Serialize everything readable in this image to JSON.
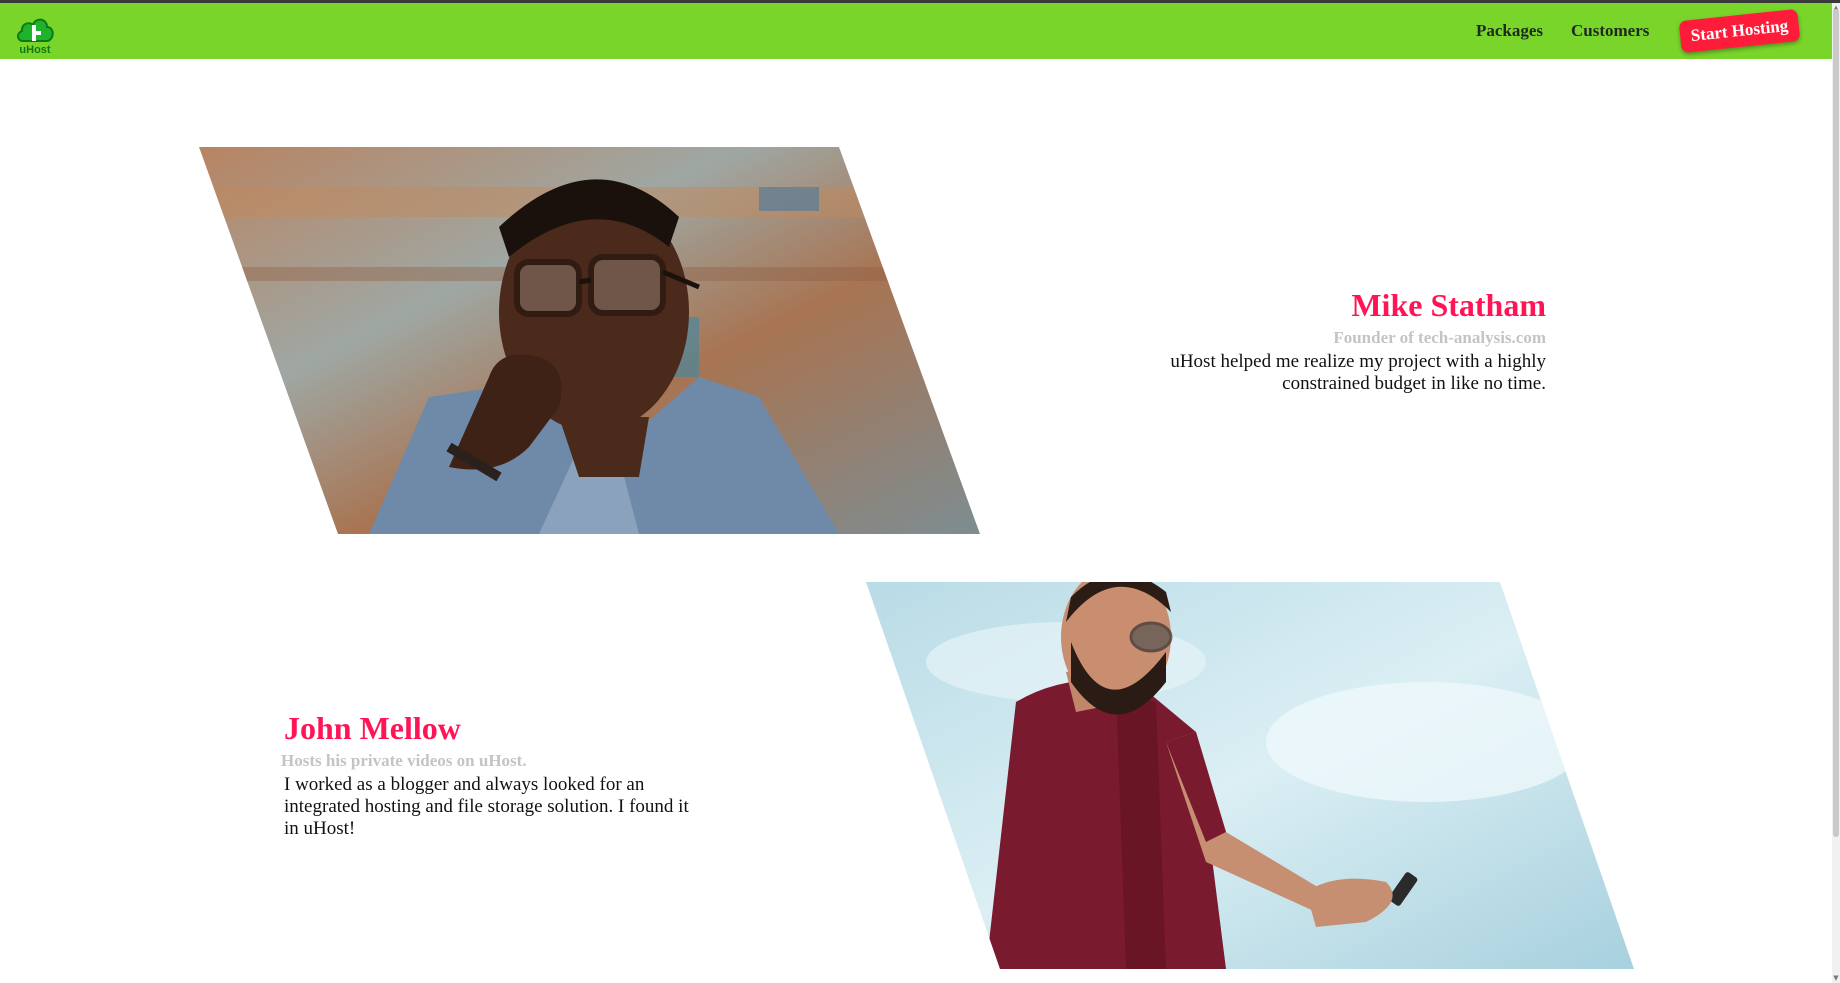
{
  "header": {
    "logo_text": "uHost",
    "nav": {
      "packages": "Packages",
      "customers": "Customers"
    },
    "cta_label": "Start Hosting"
  },
  "colors": {
    "header_bg": "#7ad52b",
    "accent": "#ff1556",
    "cta_bg": "#ff1b3a",
    "subtitle": "#c4c4c4"
  },
  "testimonials": [
    {
      "name": "Mike Statham",
      "role": "Founder of tech-analysis.com",
      "quote": "uHost helped me realize my project with a highly constrained budget in like no time.",
      "photo_icon": "man-with-glasses-photo"
    },
    {
      "name": "John Mellow",
      "role": "Hosts his private videos on uHost.",
      "quote": "I worked as a blogger and always looked for an integrated hosting and file storage solution. I found it in uHost!",
      "photo_icon": "man-with-phone-photo"
    }
  ]
}
